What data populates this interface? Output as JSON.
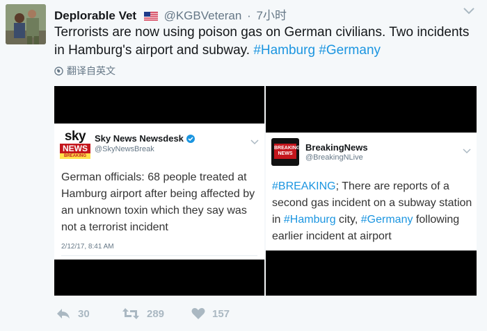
{
  "tweet": {
    "author_name": "Deplorable Vet",
    "author_handle": "@KGBVeteran",
    "separator": "·",
    "time": "7小时",
    "text_plain": "Terrorists are now using poison gas on German civilians. Two incidents in Hamburg's airport and subway.",
    "hashtags": [
      "#Hamburg",
      "#Germany"
    ],
    "translate_label": "翻译自英文"
  },
  "media": {
    "left": {
      "logo_top": "sky",
      "logo_mid": "NEWS",
      "logo_bottom": "BREAKING",
      "account_name": "Sky News Newsdesk",
      "account_handle": "@SkyNewsBreak",
      "text": "German officials: 68 people treated at Hamburg airport after being affected by an unknown toxin which they say was not a terrorist incident",
      "date": "2/12/17, 8:41 AM"
    },
    "right": {
      "logo_text": "BREAKING NEWS",
      "account_name": "BreakingNews",
      "account_handle": "@BreakingNLive",
      "segments": [
        {
          "text": "#BREAKING",
          "tag": true
        },
        {
          "text": "; There are reports of a second gas incident on a subway station in ",
          "tag": false
        },
        {
          "text": "#Hamburg",
          "tag": true
        },
        {
          "text": " city, ",
          "tag": false
        },
        {
          "text": "#Germany",
          "tag": true
        },
        {
          "text": " following earlier incident at airport",
          "tag": false
        }
      ]
    }
  },
  "actions": {
    "reply_count": "30",
    "retweet_count": "289",
    "like_count": "157"
  },
  "colors": {
    "link": "#1b95e0",
    "muted": "#657786",
    "icon": "#aab8c2",
    "background": "#f5f8fa"
  },
  "icons": [
    "globe-icon",
    "reply-icon",
    "retweet-icon",
    "heart-icon",
    "chevron-down-icon",
    "verified-icon",
    "us-flag-icon"
  ]
}
